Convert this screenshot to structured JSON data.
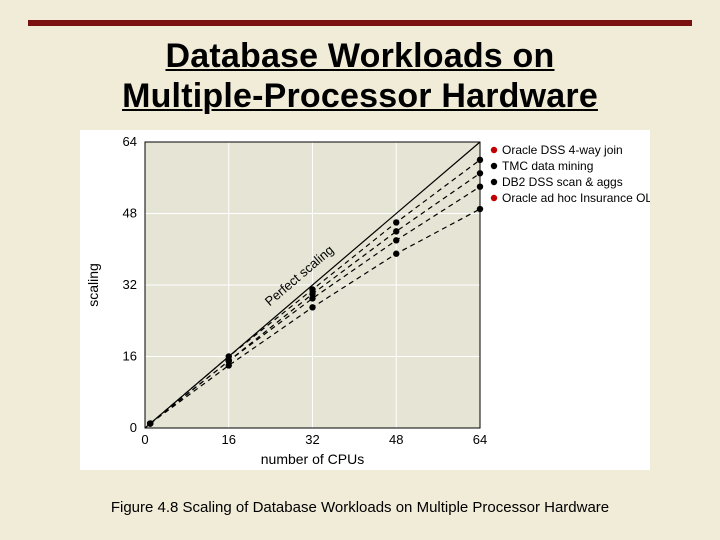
{
  "title_line1": "Database Workloads on",
  "title_line2": "Multiple-Processor Hardware",
  "caption": "Figure 4.8  Scaling of Database Workloads on Multiple Processor Hardware",
  "chart_data": {
    "type": "line",
    "title": "",
    "xlabel": "number of CPUs",
    "ylabel": "scaling",
    "xlim": [
      0,
      64
    ],
    "ylim": [
      0,
      64
    ],
    "x_ticks": [
      0,
      16,
      32,
      48,
      64
    ],
    "y_ticks": [
      0,
      16,
      32,
      48,
      64
    ],
    "perfect_scaling_label": "Perfect scaling",
    "legend_position": "right",
    "series": [
      {
        "name": "Oracle DSS 4-way join",
        "bullet": "red",
        "x": [
          1,
          16,
          32,
          48,
          64
        ],
        "y": [
          1,
          16,
          31,
          46,
          60
        ]
      },
      {
        "name": "TMC data mining",
        "bullet": "black",
        "x": [
          1,
          16,
          32,
          48,
          64
        ],
        "y": [
          1,
          15,
          30,
          44,
          57
        ]
      },
      {
        "name": "DB2 DSS scan & aggs",
        "bullet": "black",
        "x": [
          1,
          16,
          32,
          48,
          64
        ],
        "y": [
          1,
          15,
          29,
          42,
          54
        ]
      },
      {
        "name": "Oracle ad hoc Insurance OLTP",
        "bullet": "red",
        "x": [
          1,
          16,
          32,
          48,
          64
        ],
        "y": [
          1,
          14,
          27,
          39,
          49
        ]
      }
    ]
  }
}
